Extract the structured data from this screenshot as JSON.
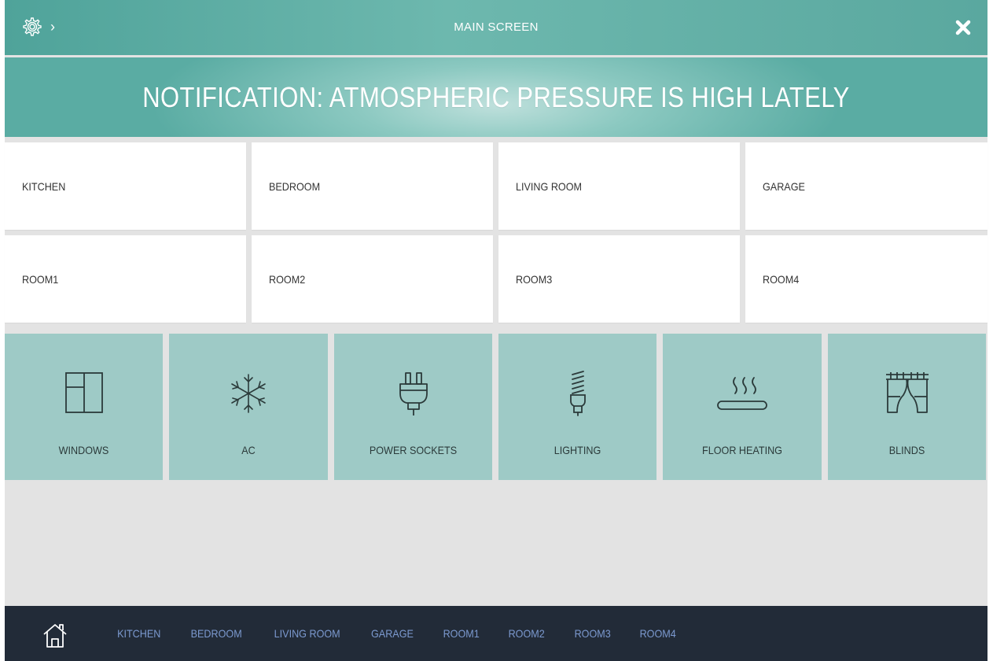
{
  "header": {
    "title": "MAIN SCREEN",
    "settings_icon": "gear-icon",
    "chevron": "›",
    "close_icon": "close-icon"
  },
  "notification": {
    "text": "NOTIFICATION: ATMOSPHERIC PRESSURE IS HIGH LATELY"
  },
  "rooms": [
    {
      "label": "KITCHEN"
    },
    {
      "label": "BEDROOM"
    },
    {
      "label": "LIVING ROOM"
    },
    {
      "label": "GARAGE"
    },
    {
      "label": "ROOM1"
    },
    {
      "label": "ROOM2"
    },
    {
      "label": "ROOM3"
    },
    {
      "label": "ROOM4"
    }
  ],
  "devices": [
    {
      "label": "WINDOWS",
      "icon": "window-icon"
    },
    {
      "label": "AC",
      "icon": "snowflake-icon"
    },
    {
      "label": "POWER SOCKETS",
      "icon": "plug-icon"
    },
    {
      "label": "LIGHTING",
      "icon": "bulb-icon"
    },
    {
      "label": "FLOOR HEATING",
      "icon": "floor-heating-icon"
    },
    {
      "label": "BLINDS",
      "icon": "blinds-icon"
    }
  ],
  "bottom_nav": {
    "home_icon": "home-icon",
    "links": [
      "KITCHEN",
      "BEDROOM",
      "LIVING ROOM",
      "GARAGE",
      "ROOM1",
      "ROOM2",
      "ROOM3",
      "ROOM4"
    ]
  },
  "colors": {
    "accent_teal": "#5aa89f",
    "tile_teal": "#9ecac6",
    "nav_dark": "#222b38",
    "nav_link": "#7c9ad0"
  }
}
